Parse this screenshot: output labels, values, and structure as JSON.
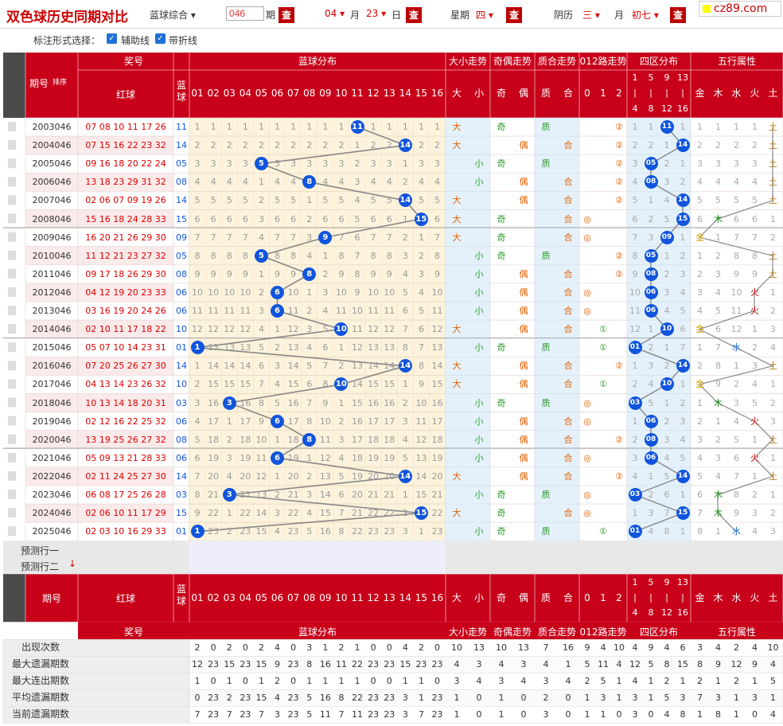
{
  "header": {
    "title": "双色球历史同期对比",
    "mode": "蓝球综合",
    "period_value": "046",
    "period_label": "期",
    "query": "查",
    "month_num": "04",
    "month_label": "月",
    "day_num": "23",
    "day_label": "日",
    "week_label": "星期",
    "week_val": "四",
    "lunar_label": "阴历",
    "lunar_month": "三",
    "lunar_month_label": "月",
    "lunar_day": "初七",
    "logo": "cz89.com"
  },
  "options": {
    "label": "标注形式选择：",
    "aux": "辅助线",
    "fold": "带折线"
  },
  "table_head": {
    "qihao": "期号",
    "sort": "排序",
    "jianghao": "奖号",
    "red": "红球",
    "blue": "蓝球",
    "blue_dist": "蓝球分布",
    "daxiao": "大小走势",
    "jiou": "奇偶走势",
    "zhihe": "质合走势",
    "lu012": "012路走势",
    "siqu": "四区分布",
    "wuxing": "五行属性",
    "nums": [
      "01",
      "02",
      "03",
      "04",
      "05",
      "06",
      "07",
      "08",
      "09",
      "10",
      "11",
      "12",
      "13",
      "14",
      "15",
      "16"
    ],
    "dx": [
      "大",
      "小"
    ],
    "jo": [
      "奇",
      "偶"
    ],
    "zh": [
      "质",
      "合"
    ],
    "lu": [
      "0",
      "1",
      "2"
    ],
    "sq": [
      "1|4",
      "5|8",
      "9|12",
      "13|16"
    ],
    "wx": [
      "金",
      "木",
      "水",
      "火",
      "土"
    ]
  },
  "rows": [
    {
      "issue": "2003046",
      "red": "07 08 10 11 17 26",
      "blue": "11",
      "dist": [
        1,
        1,
        1,
        1,
        1,
        1,
        1,
        1,
        1,
        1,
        0,
        1,
        1,
        1,
        1,
        1
      ],
      "dx": "大",
      "jo": "奇",
      "zh": "质",
      "lu": "2",
      "sq": [
        1,
        1,
        0,
        1
      ],
      "wx": [
        1,
        1,
        1,
        1,
        "土"
      ]
    },
    {
      "issue": "2004046",
      "red": "07 15 16 22 23 32",
      "blue": "14",
      "dist": [
        2,
        2,
        2,
        2,
        2,
        2,
        2,
        2,
        2,
        2,
        1,
        2,
        2,
        0,
        2,
        2
      ],
      "dx": "大",
      "jo": "偶",
      "zh": "合",
      "lu": "2",
      "sq": [
        2,
        2,
        1,
        0
      ],
      "wx": [
        2,
        2,
        2,
        2,
        "土"
      ]
    },
    {
      "issue": "2005046",
      "red": "09 16 18 20 22 24",
      "blue": "05",
      "dist": [
        3,
        3,
        3,
        3,
        0,
        3,
        3,
        3,
        3,
        3,
        2,
        3,
        3,
        1,
        3,
        3
      ],
      "dx": "小",
      "jo": "奇",
      "zh": "质",
      "lu": "2",
      "sq": [
        3,
        0,
        2,
        1
      ],
      "wx": [
        3,
        3,
        3,
        3,
        "土"
      ]
    },
    {
      "issue": "2006046",
      "red": "13 18 23 29 31 32",
      "blue": "08",
      "dist": [
        4,
        4,
        4,
        4,
        1,
        4,
        4,
        0,
        4,
        4,
        3,
        4,
        4,
        2,
        4,
        4
      ],
      "dx": "小",
      "jo": "偶",
      "zh": "合",
      "lu": "2",
      "sq": [
        4,
        0,
        3,
        2
      ],
      "wx": [
        4,
        4,
        4,
        4,
        "土"
      ]
    },
    {
      "issue": "2007046",
      "red": "02 06 07 09 19 26",
      "blue": "14",
      "dist": [
        5,
        5,
        5,
        5,
        2,
        5,
        5,
        1,
        5,
        5,
        4,
        5,
        5,
        0,
        5,
        5
      ],
      "dx": "大",
      "jo": "偶",
      "zh": "合",
      "lu": "2",
      "sq": [
        5,
        1,
        4,
        0
      ],
      "wx": [
        5,
        5,
        5,
        5,
        "土"
      ]
    },
    {
      "issue": "2008046",
      "red": "15 16 18 24 28 33",
      "blue": "15",
      "dist": [
        6,
        6,
        6,
        6,
        3,
        6,
        6,
        2,
        6,
        6,
        5,
        6,
        6,
        1,
        0,
        6
      ],
      "dx": "大",
      "jo": "奇",
      "zh": "合",
      "lu": "0",
      "sq": [
        6,
        2,
        5,
        0
      ],
      "wx": [
        6,
        "木",
        6,
        6,
        1
      ]
    },
    {
      "issue": "2009046",
      "red": "16 20 21 26 29 30",
      "blue": "09",
      "dist": [
        7,
        7,
        7,
        7,
        4,
        7,
        7,
        3,
        0,
        7,
        6,
        7,
        7,
        2,
        1,
        7
      ],
      "dx": "大",
      "jo": "奇",
      "zh": "合",
      "lu": "0",
      "sq": [
        7,
        3,
        0,
        1
      ],
      "wx": [
        "金",
        1,
        7,
        7,
        2
      ]
    },
    {
      "issue": "2010046",
      "red": "11 12 21 23 27 32",
      "blue": "05",
      "dist": [
        8,
        8,
        8,
        8,
        0,
        8,
        8,
        4,
        1,
        8,
        7,
        8,
        8,
        3,
        2,
        8
      ],
      "dx": "小",
      "jo": "奇",
      "zh": "质",
      "lu": "2",
      "sq": [
        8,
        0,
        1,
        2
      ],
      "wx": [
        1,
        2,
        8,
        8,
        "土"
      ]
    },
    {
      "issue": "2011046",
      "red": "09 17 18 26 29 30",
      "blue": "08",
      "dist": [
        9,
        9,
        9,
        9,
        1,
        9,
        9,
        0,
        2,
        9,
        8,
        9,
        9,
        4,
        3,
        9
      ],
      "dx": "小",
      "jo": "偶",
      "zh": "合",
      "lu": "2",
      "sq": [
        9,
        0,
        2,
        3
      ],
      "wx": [
        2,
        3,
        9,
        9,
        "土"
      ]
    },
    {
      "issue": "2012046",
      "red": "04 12 19 20 23 33",
      "blue": "06",
      "dist": [
        10,
        10,
        10,
        10,
        2,
        0,
        10,
        1,
        3,
        10,
        9,
        10,
        10,
        5,
        4,
        10
      ],
      "dx": "小",
      "jo": "偶",
      "zh": "合",
      "lu": "0",
      "sq": [
        10,
        0,
        3,
        4
      ],
      "wx": [
        3,
        4,
        10,
        "火",
        1
      ]
    },
    {
      "issue": "2013046",
      "red": "03 16 19 20 24 26",
      "blue": "06",
      "dist": [
        11,
        11,
        11,
        11,
        3,
        0,
        11,
        2,
        4,
        11,
        10,
        11,
        11,
        6,
        5,
        11
      ],
      "dx": "小",
      "jo": "偶",
      "zh": "合",
      "lu": "0",
      "sq": [
        11,
        0,
        4,
        5
      ],
      "wx": [
        4,
        5,
        11,
        "火",
        2
      ]
    },
    {
      "issue": "2014046",
      "red": "02 10 11 17 18 22",
      "blue": "10",
      "dist": [
        12,
        12,
        12,
        12,
        4,
        1,
        12,
        3,
        5,
        0,
        11,
        12,
        12,
        7,
        6,
        12
      ],
      "dx": "大",
      "jo": "偶",
      "zh": "合",
      "lu": "1",
      "sq": [
        12,
        1,
        0,
        6
      ],
      "wx": [
        "金",
        6,
        12,
        1,
        3
      ]
    },
    {
      "issue": "2015046",
      "red": "05 07 10 14 23 31",
      "blue": "01",
      "dist": [
        0,
        13,
        13,
        13,
        5,
        2,
        13,
        4,
        6,
        1,
        12,
        13,
        13,
        8,
        7,
        13
      ],
      "dx": "小",
      "jo": "奇",
      "zh": "质",
      "lu": "1",
      "sq": [
        0,
        2,
        1,
        7
      ],
      "wx": [
        1,
        7,
        "水",
        2,
        4
      ]
    },
    {
      "issue": "2016046",
      "red": "07 20 25 26 27 30",
      "blue": "14",
      "dist": [
        1,
        14,
        14,
        14,
        6,
        3,
        14,
        5,
        7,
        2,
        13,
        14,
        14,
        0,
        8,
        14
      ],
      "dx": "大",
      "jo": "偶",
      "zh": "合",
      "lu": "2",
      "sq": [
        1,
        3,
        2,
        0
      ],
      "wx": [
        2,
        8,
        1,
        3,
        "土"
      ]
    },
    {
      "issue": "2017046",
      "red": "04 13 14 23 26 32",
      "blue": "10",
      "dist": [
        2,
        15,
        15,
        15,
        7,
        4,
        15,
        6,
        8,
        0,
        14,
        15,
        15,
        1,
        9,
        15
      ],
      "dx": "大",
      "jo": "偶",
      "zh": "合",
      "lu": "1",
      "sq": [
        2,
        4,
        0,
        1
      ],
      "wx": [
        "金",
        9,
        2,
        4,
        1
      ]
    },
    {
      "issue": "2018046",
      "red": "10 13 14 18 20 31",
      "blue": "03",
      "dist": [
        3,
        16,
        0,
        16,
        8,
        5,
        16,
        7,
        9,
        1,
        15,
        16,
        16,
        2,
        10,
        16
      ],
      "dx": "小",
      "jo": "奇",
      "zh": "质",
      "lu": "0",
      "sq": [
        0,
        5,
        1,
        2
      ],
      "wx": [
        1,
        "木",
        3,
        5,
        2
      ]
    },
    {
      "issue": "2019046",
      "red": "02 12 16 22 25 32",
      "blue": "06",
      "dist": [
        4,
        17,
        1,
        17,
        9,
        0,
        17,
        8,
        10,
        2,
        16,
        17,
        17,
        3,
        11,
        17
      ],
      "dx": "小",
      "jo": "偶",
      "zh": "合",
      "lu": "0",
      "sq": [
        1,
        0,
        2,
        3
      ],
      "wx": [
        2,
        1,
        4,
        "火",
        3
      ]
    },
    {
      "issue": "2020046",
      "red": "13 19 25 26 27 32",
      "blue": "08",
      "dist": [
        5,
        18,
        2,
        18,
        10,
        1,
        18,
        0,
        11,
        3,
        17,
        18,
        18,
        4,
        12,
        18
      ],
      "dx": "小",
      "jo": "偶",
      "zh": "合",
      "lu": "2",
      "sq": [
        2,
        0,
        3,
        4
      ],
      "wx": [
        3,
        2,
        5,
        1,
        "土"
      ]
    },
    {
      "issue": "2021046",
      "red": "05 09 13 21 28 33",
      "blue": "06",
      "dist": [
        6,
        19,
        3,
        19,
        11,
        0,
        19,
        1,
        12,
        4,
        18,
        19,
        19,
        5,
        13,
        19
      ],
      "dx": "小",
      "jo": "偶",
      "zh": "合",
      "lu": "0",
      "sq": [
        3,
        0,
        4,
        5
      ],
      "wx": [
        4,
        3,
        6,
        "火",
        1
      ]
    },
    {
      "issue": "2022046",
      "red": "02 11 24 25 27 30",
      "blue": "14",
      "dist": [
        7,
        20,
        4,
        20,
        12,
        1,
        20,
        2,
        13,
        5,
        19,
        20,
        20,
        0,
        14,
        20
      ],
      "dx": "大",
      "jo": "偶",
      "zh": "合",
      "lu": "2",
      "sq": [
        4,
        1,
        5,
        0
      ],
      "wx": [
        5,
        4,
        7,
        1,
        "土"
      ]
    },
    {
      "issue": "2023046",
      "red": "06 08 17 25 26 28",
      "blue": "03",
      "dist": [
        8,
        21,
        0,
        21,
        13,
        2,
        21,
        3,
        14,
        6,
        20,
        21,
        21,
        1,
        15,
        21
      ],
      "dx": "小",
      "jo": "奇",
      "zh": "质",
      "lu": "0",
      "sq": [
        0,
        2,
        6,
        1
      ],
      "wx": [
        6,
        "木",
        8,
        2,
        1
      ]
    },
    {
      "issue": "2024046",
      "red": "02 06 10 11 17 29",
      "blue": "15",
      "dist": [
        9,
        22,
        1,
        22,
        14,
        3,
        22,
        4,
        15,
        7,
        21,
        22,
        22,
        2,
        0,
        22
      ],
      "dx": "大",
      "jo": "奇",
      "zh": "合",
      "lu": "0",
      "sq": [
        1,
        3,
        7,
        0
      ],
      "wx": [
        7,
        "木",
        9,
        3,
        2
      ]
    },
    {
      "issue": "2025046",
      "red": "02 03 10 16 29 33",
      "blue": "01",
      "dist": [
        0,
        23,
        2,
        23,
        15,
        4,
        23,
        5,
        16,
        8,
        22,
        23,
        23,
        3,
        1,
        23
      ],
      "dx": "小",
      "jo": "奇",
      "zh": "质",
      "lu": "1",
      "sq": [
        0,
        4,
        8,
        1
      ],
      "wx": [
        8,
        1,
        "水",
        4,
        3
      ]
    }
  ],
  "predict": {
    "row1": "预测行一",
    "row2": "预测行二"
  },
  "stats": [
    {
      "label": "出现次数",
      "vals": [
        2,
        0,
        2,
        0,
        2,
        4,
        0,
        3,
        1,
        2,
        1,
        0,
        0,
        4,
        2,
        0,
        10,
        13,
        10,
        13,
        7,
        16,
        9,
        4,
        10,
        4,
        9,
        4,
        6,
        3,
        4,
        2,
        4,
        10
      ]
    },
    {
      "label": "最大遗漏期数",
      "vals": [
        12,
        23,
        15,
        23,
        15,
        9,
        23,
        8,
        16,
        11,
        22,
        23,
        23,
        15,
        23,
        23,
        4,
        3,
        4,
        3,
        4,
        1,
        5,
        11,
        4,
        12,
        5,
        8,
        15,
        8,
        9,
        12,
        9,
        4
      ]
    },
    {
      "label": "最大连出期数",
      "vals": [
        1,
        0,
        1,
        0,
        1,
        2,
        0,
        1,
        1,
        1,
        1,
        0,
        0,
        1,
        1,
        0,
        3,
        4,
        3,
        4,
        3,
        4,
        2,
        5,
        1,
        4,
        1,
        2,
        1,
        2,
        1,
        2,
        1,
        5
      ]
    },
    {
      "label": "平均遗漏期数",
      "vals": [
        0,
        23,
        2,
        23,
        15,
        4,
        23,
        5,
        16,
        8,
        22,
        23,
        23,
        3,
        1,
        23,
        1,
        0,
        1,
        0,
        2,
        0,
        1,
        3,
        1,
        3,
        1,
        5,
        3,
        7,
        3,
        1,
        3,
        1
      ]
    },
    {
      "label": "当前遗漏期数",
      "vals": [
        7,
        23,
        7,
        23,
        7,
        3,
        23,
        5,
        11,
        7,
        11,
        23,
        23,
        3,
        7,
        23,
        1,
        0,
        1,
        0,
        3,
        0,
        1,
        1,
        0,
        3,
        0,
        4,
        8,
        1,
        8,
        1,
        0,
        4
      ]
    }
  ],
  "colors": {
    "header_red": "#c8001a",
    "blue_ball": "#1155dd",
    "grid": "#e4c9b8"
  }
}
